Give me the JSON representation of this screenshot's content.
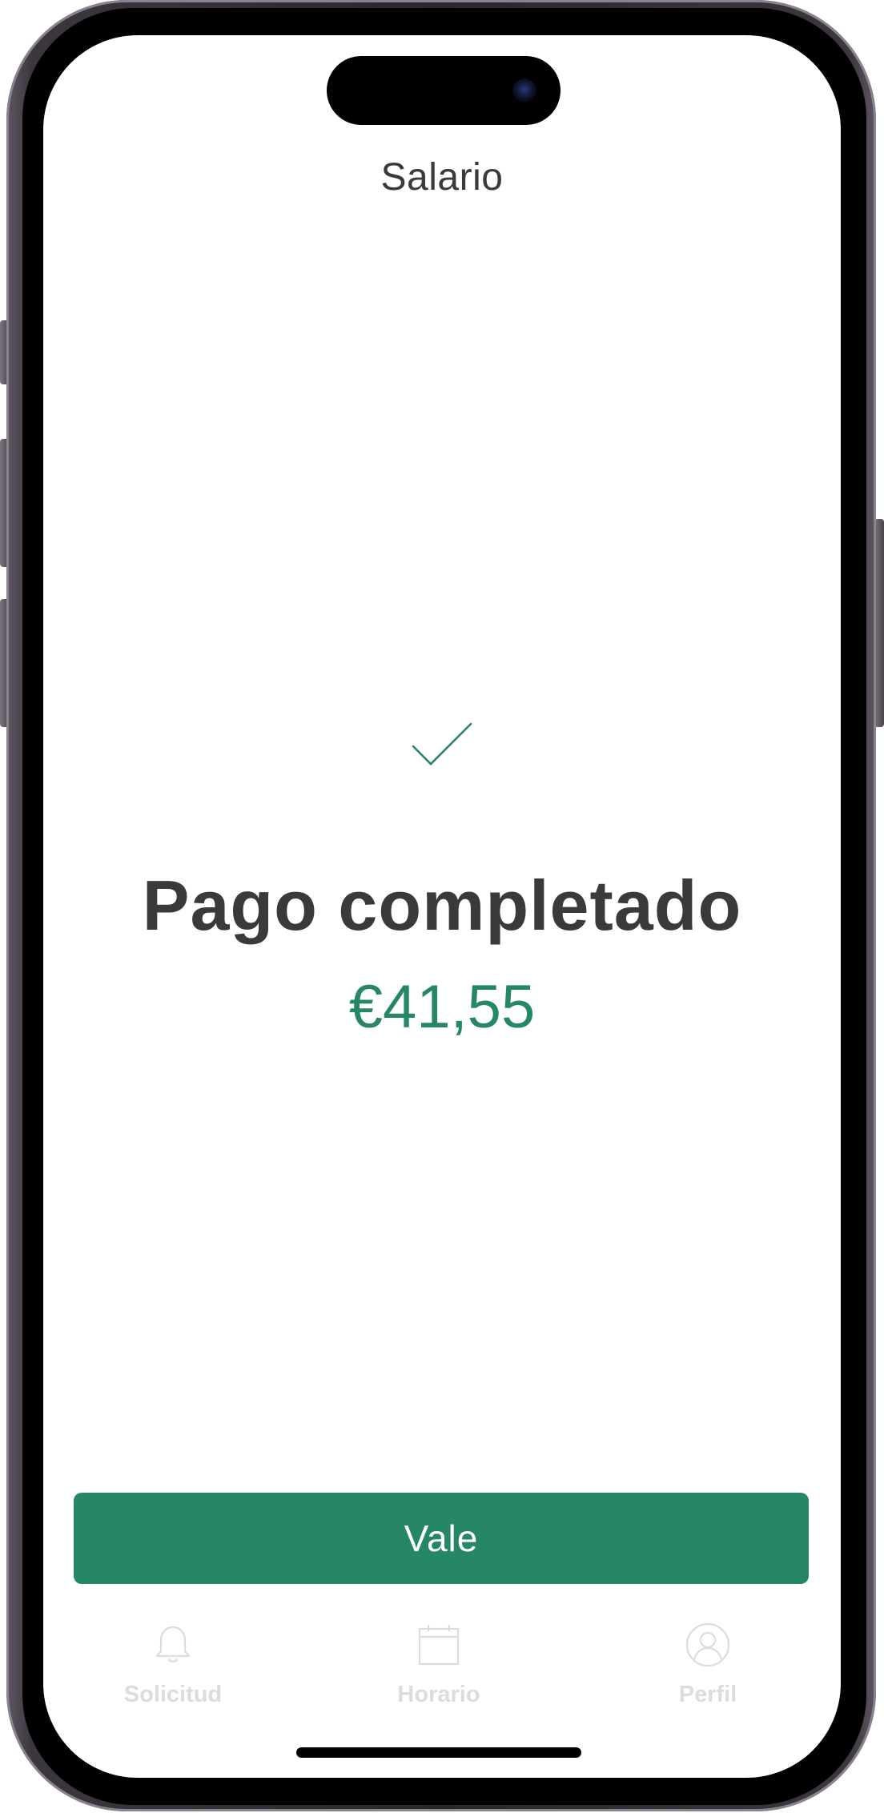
{
  "header": {
    "title": "Salario"
  },
  "confirmation": {
    "icon": "checkmark-icon",
    "headline": "Pago completado",
    "amount": "€41,55",
    "accent_color": "#268764"
  },
  "primary_action": {
    "label": "Vale"
  },
  "tab_bar": {
    "items": [
      {
        "label": "Solicitud",
        "icon": "bell-icon"
      },
      {
        "label": "Horario",
        "icon": "calendar-icon"
      },
      {
        "label": "Perfil",
        "icon": "user-icon"
      }
    ]
  }
}
